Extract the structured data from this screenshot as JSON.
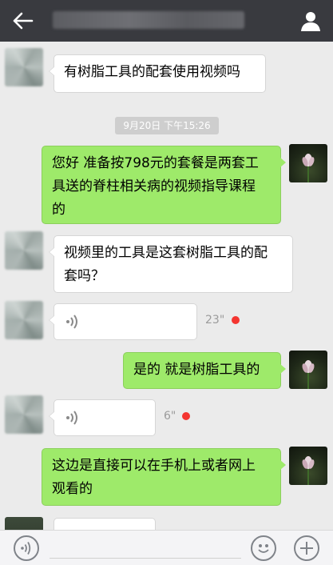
{
  "topbar": {
    "title": "",
    "back_icon": "arrow-left-icon",
    "profile_icon": "person-icon"
  },
  "timestamp": "9月20日 下午15:26",
  "messages": [
    {
      "side": "left",
      "type": "text",
      "text": "有树脂工具的配套使用视频吗"
    },
    {
      "side": "right",
      "type": "text",
      "text": "您好 准备按798元的套餐是两套工具送的脊柱相关病的视频指导课程的"
    },
    {
      "side": "left",
      "type": "text",
      "text": "视频里的工具是这套树脂工具的配套吗？"
    },
    {
      "side": "left",
      "type": "voice",
      "duration": "23\"",
      "unread": true
    },
    {
      "side": "right",
      "type": "text",
      "text": "是的 就是树脂工具的"
    },
    {
      "side": "left",
      "type": "voice",
      "duration": "6\"",
      "unread": true
    },
    {
      "side": "right",
      "type": "text",
      "text": "这边是直接可以在手机上或者网上观看的"
    }
  ],
  "message_lines": {
    "m2": [
      "您好 准备按798元的套餐是两套工",
      "具送的脊柱相关病的视频指导课程",
      "的"
    ],
    "m3": [
      "视频里的工具是这套树脂工具的配",
      "套吗？"
    ],
    "m7": [
      "这边是直接可以在手机上或者网上",
      "观看的"
    ]
  },
  "bottombar": {
    "voice_icon": "voice-wave-icon",
    "emoji_icon": "smiley-icon",
    "plus_icon": "plus-icon"
  },
  "colors": {
    "topbar": "#393a3f",
    "background": "#ebebeb",
    "sent_bubble": "#9eea6a",
    "received_bubble": "#ffffff",
    "unread_dot": "#f43530"
  }
}
